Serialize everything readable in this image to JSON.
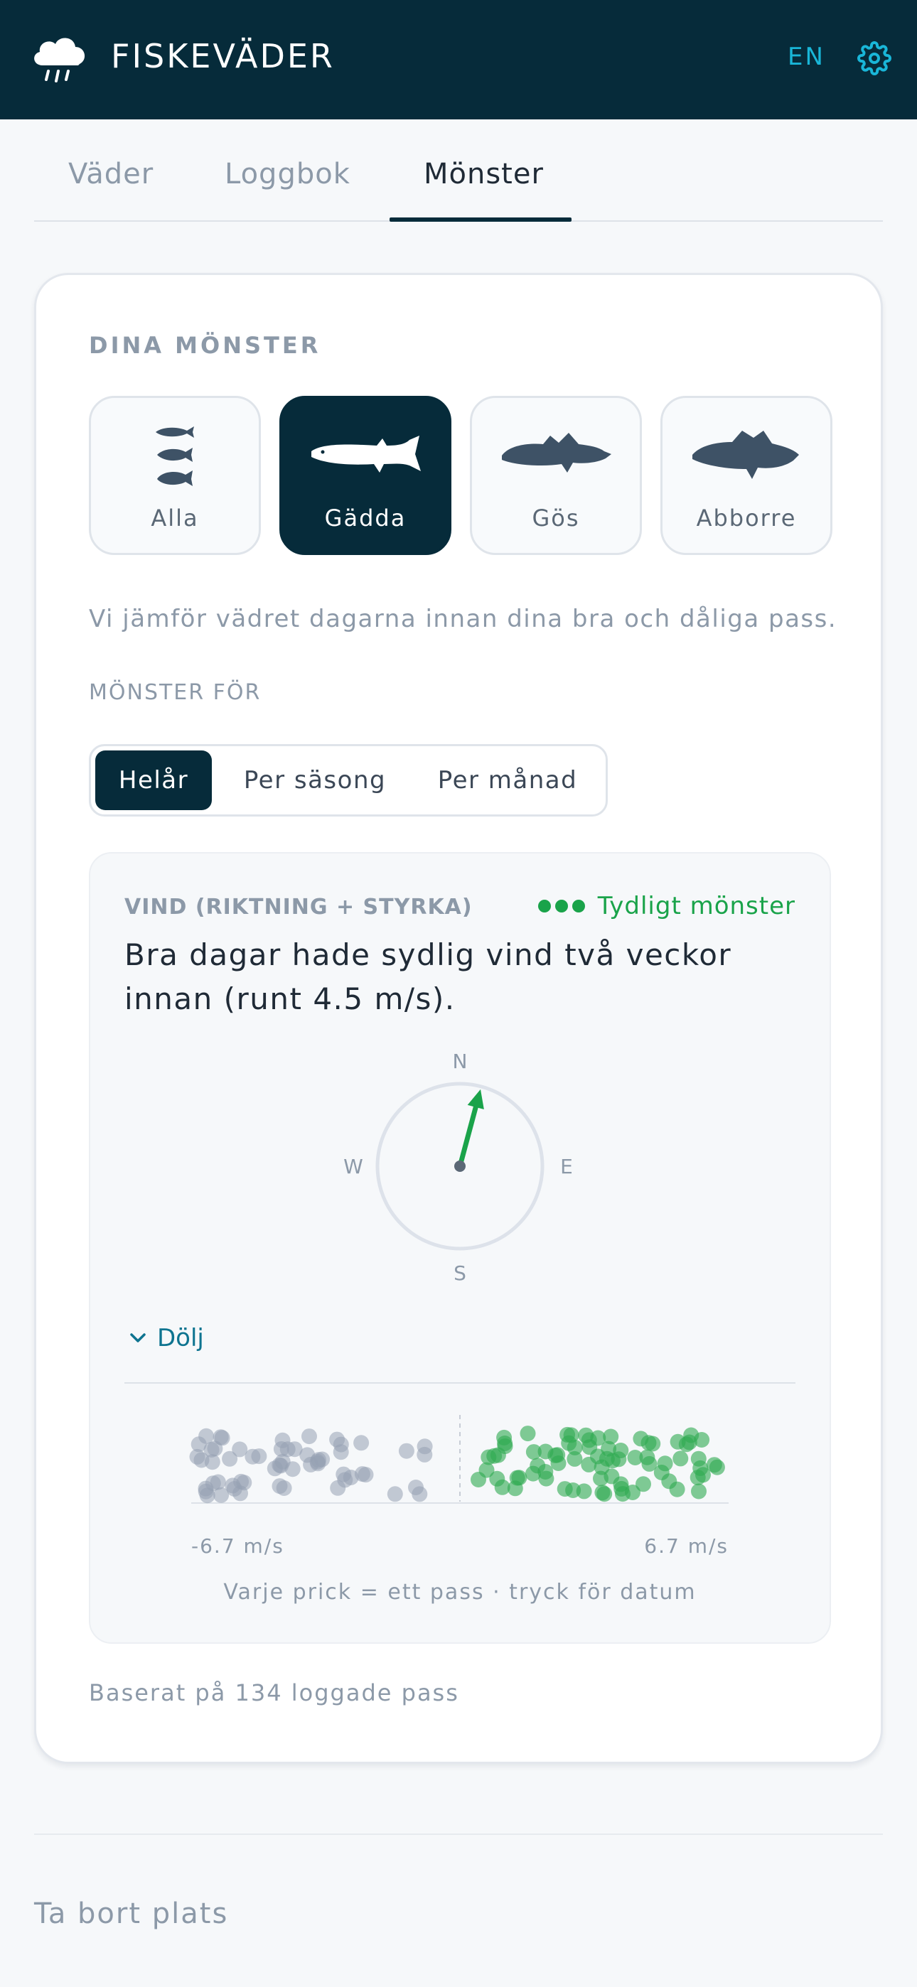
{
  "header": {
    "title": "FISKEVÄDER",
    "lang": "EN"
  },
  "tabs": [
    {
      "label": "Väder",
      "active": false
    },
    {
      "label": "Loggbok",
      "active": false
    },
    {
      "label": "Mönster",
      "active": true
    }
  ],
  "card": {
    "title": "DINA MÖNSTER",
    "species": [
      {
        "label": "Alla",
        "icon": "all-fish-icon",
        "active": false
      },
      {
        "label": "Gädda",
        "icon": "pike-icon",
        "active": true
      },
      {
        "label": "Gös",
        "icon": "zander-icon",
        "active": false
      },
      {
        "label": "Abborre",
        "icon": "perch-icon",
        "active": false
      }
    ],
    "description": "Vi jämför vädret dagarna innan dina bra och dåliga pass.",
    "pattern_for_label": "MÖNSTER FÖR",
    "periods": [
      {
        "label": "Helår",
        "active": true
      },
      {
        "label": "Per säsong",
        "active": false
      },
      {
        "label": "Per månad",
        "active": false
      }
    ],
    "metric": {
      "title": "VIND (RIKTNING + STYRKA)",
      "strength": "Tydligt mönster",
      "strength_dots": 3,
      "insight": "Bra dagar hade sydlig vind två veckor innan (runt 4.5 m/s).",
      "compass": {
        "n": "N",
        "e": "E",
        "s": "S",
        "w": "W",
        "arrow_bearing_deg": 15
      },
      "toggle_label": "Dölj",
      "axis_min_label": "-6.7 m/s",
      "axis_max_label": "6.7 m/s",
      "hint": "Varje prick = ett pass · tryck för datum"
    },
    "based_on": "Baserat på 134 loggade pass"
  },
  "footer": {
    "delete_label": "Ta bort plats"
  },
  "colors": {
    "header_bg": "#062b3a",
    "accent": "#19b6d8",
    "good": "#1aa34a",
    "bad": "#9aa3b2"
  }
}
